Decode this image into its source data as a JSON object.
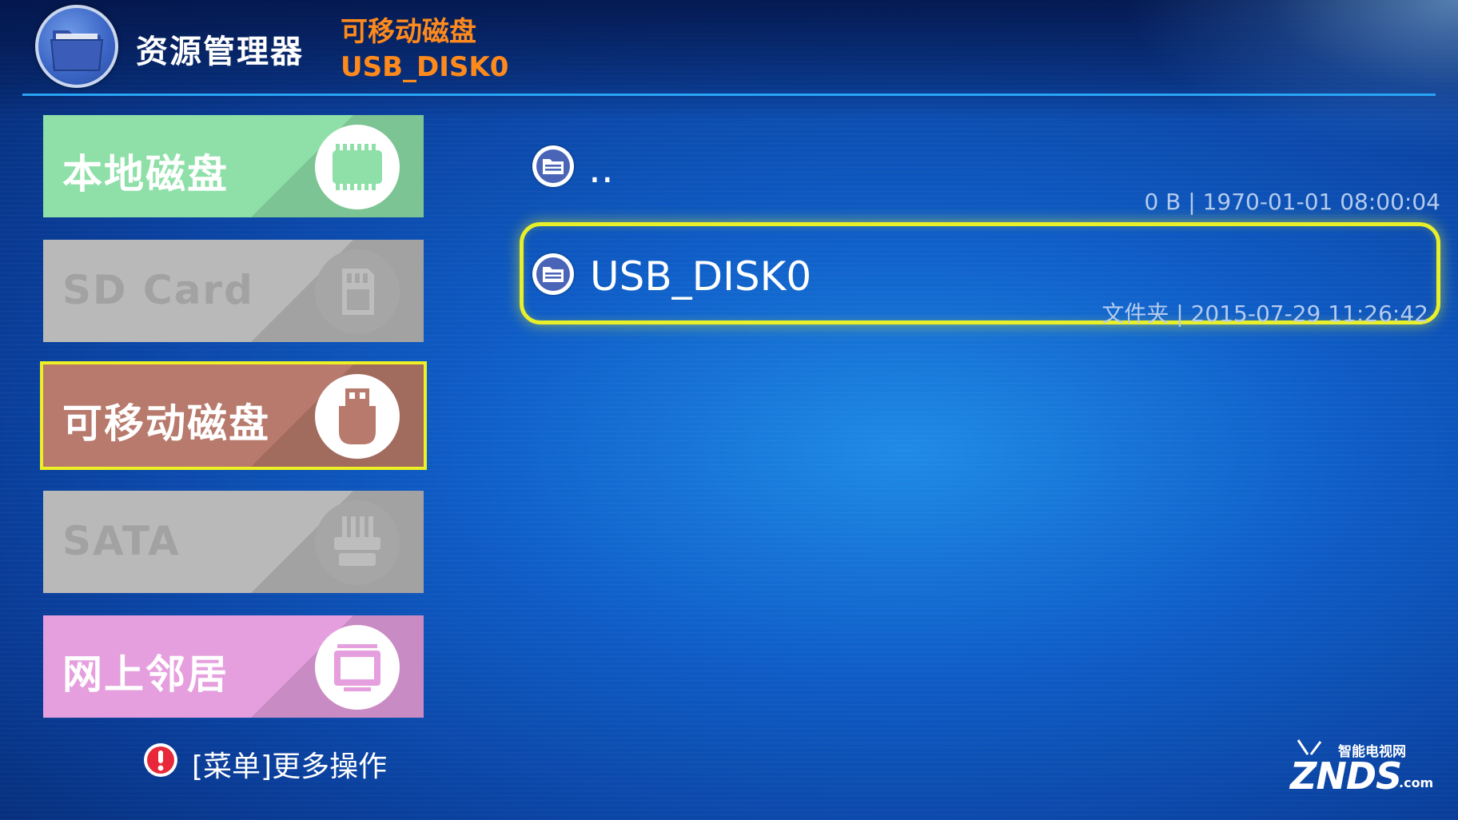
{
  "header": {
    "app_title": "资源管理器",
    "breadcrumb_category": "可移动磁盘",
    "breadcrumb_device": "USB_DISK0",
    "logo_icon": "folder-icon"
  },
  "sidebar": {
    "items": [
      {
        "label": "本地磁盘",
        "icon": "memory-chip-icon",
        "color": "#8ee0a8",
        "state": "enabled"
      },
      {
        "label": "SD Card",
        "icon": "sd-card-icon",
        "color": "#b9b9b9",
        "state": "disabled"
      },
      {
        "label": "可移动磁盘",
        "icon": "usb-drive-icon",
        "color": "#b87a6c",
        "state": "focused"
      },
      {
        "label": "SATA",
        "icon": "sata-connector-icon",
        "color": "#b9b9b9",
        "state": "disabled"
      },
      {
        "label": "网上邻居",
        "icon": "network-monitor-icon",
        "color": "#e59fde",
        "state": "enabled"
      }
    ]
  },
  "hint": {
    "icon": "exclamation-icon",
    "text": "[菜单]更多操作"
  },
  "files": [
    {
      "name": "..",
      "meta": "0 B | 1970-01-01 08:00:04",
      "icon": "folder-icon",
      "selected": false
    },
    {
      "name": "USB_DISK0",
      "meta": "文件夹 | 2015-07-29 11:26:42",
      "icon": "folder-icon",
      "selected": true
    }
  ],
  "watermark": {
    "top_text": "智能电视网",
    "brand": "ZNDS",
    "suffix": ".com"
  },
  "colors": {
    "accent_orange": "#ff8a1c",
    "focus_yellow": "#e8f02a",
    "divider_blue": "#2aa4f4"
  }
}
